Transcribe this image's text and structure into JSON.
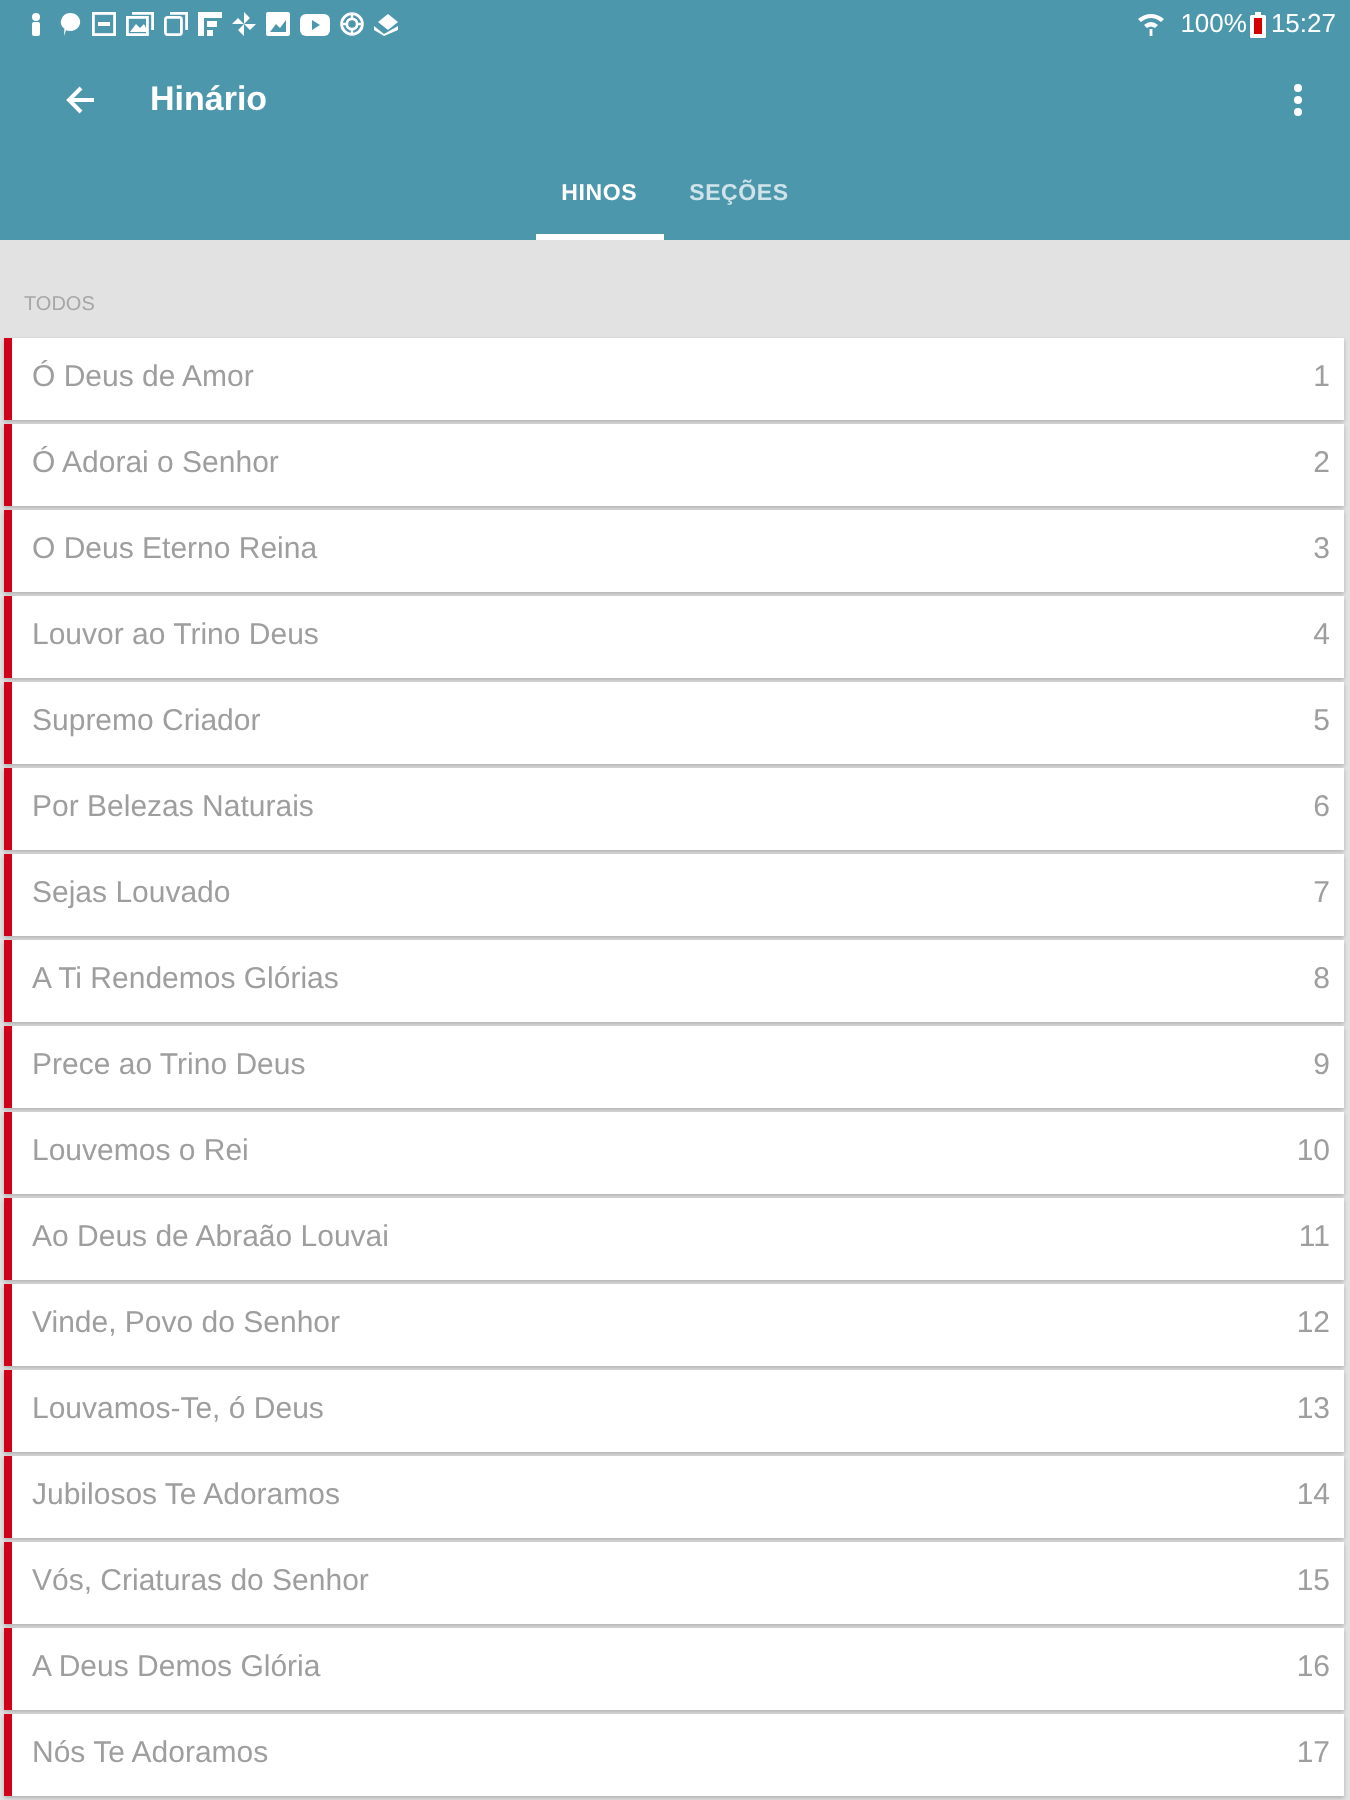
{
  "status_bar": {
    "battery": "100%",
    "time": "15:27"
  },
  "toolbar": {
    "title": "Hinário"
  },
  "tabs": [
    {
      "label": "HINOS",
      "selected": true
    },
    {
      "label": "SEÇÕES",
      "selected": false
    }
  ],
  "section": {
    "title": "TODOS"
  },
  "hymns": [
    {
      "title": "Ó Deus de Amor",
      "number": "1"
    },
    {
      "title": "Ó Adorai o Senhor",
      "number": "2"
    },
    {
      "title": "O Deus Eterno Reina",
      "number": "3"
    },
    {
      "title": "Louvor ao Trino Deus",
      "number": "4"
    },
    {
      "title": "Supremo Criador",
      "number": "5"
    },
    {
      "title": "Por Belezas Naturais",
      "number": "6"
    },
    {
      "title": "Sejas Louvado",
      "number": "7"
    },
    {
      "title": "A Ti Rendemos Glórias",
      "number": "8"
    },
    {
      "title": "Prece ao Trino Deus",
      "number": "9"
    },
    {
      "title": "Louvemos o Rei",
      "number": "10"
    },
    {
      "title": "Ao Deus de Abraão Louvai",
      "number": "11"
    },
    {
      "title": "Vinde, Povo do Senhor",
      "number": "12"
    },
    {
      "title": "Louvamos-Te, ó Deus",
      "number": "13"
    },
    {
      "title": "Jubilosos Te Adoramos",
      "number": "14"
    },
    {
      "title": "Vós, Criaturas do Senhor",
      "number": "15"
    },
    {
      "title": "A Deus Demos Glória",
      "number": "16"
    },
    {
      "title": "Nós Te Adoramos",
      "number": "17"
    }
  ]
}
